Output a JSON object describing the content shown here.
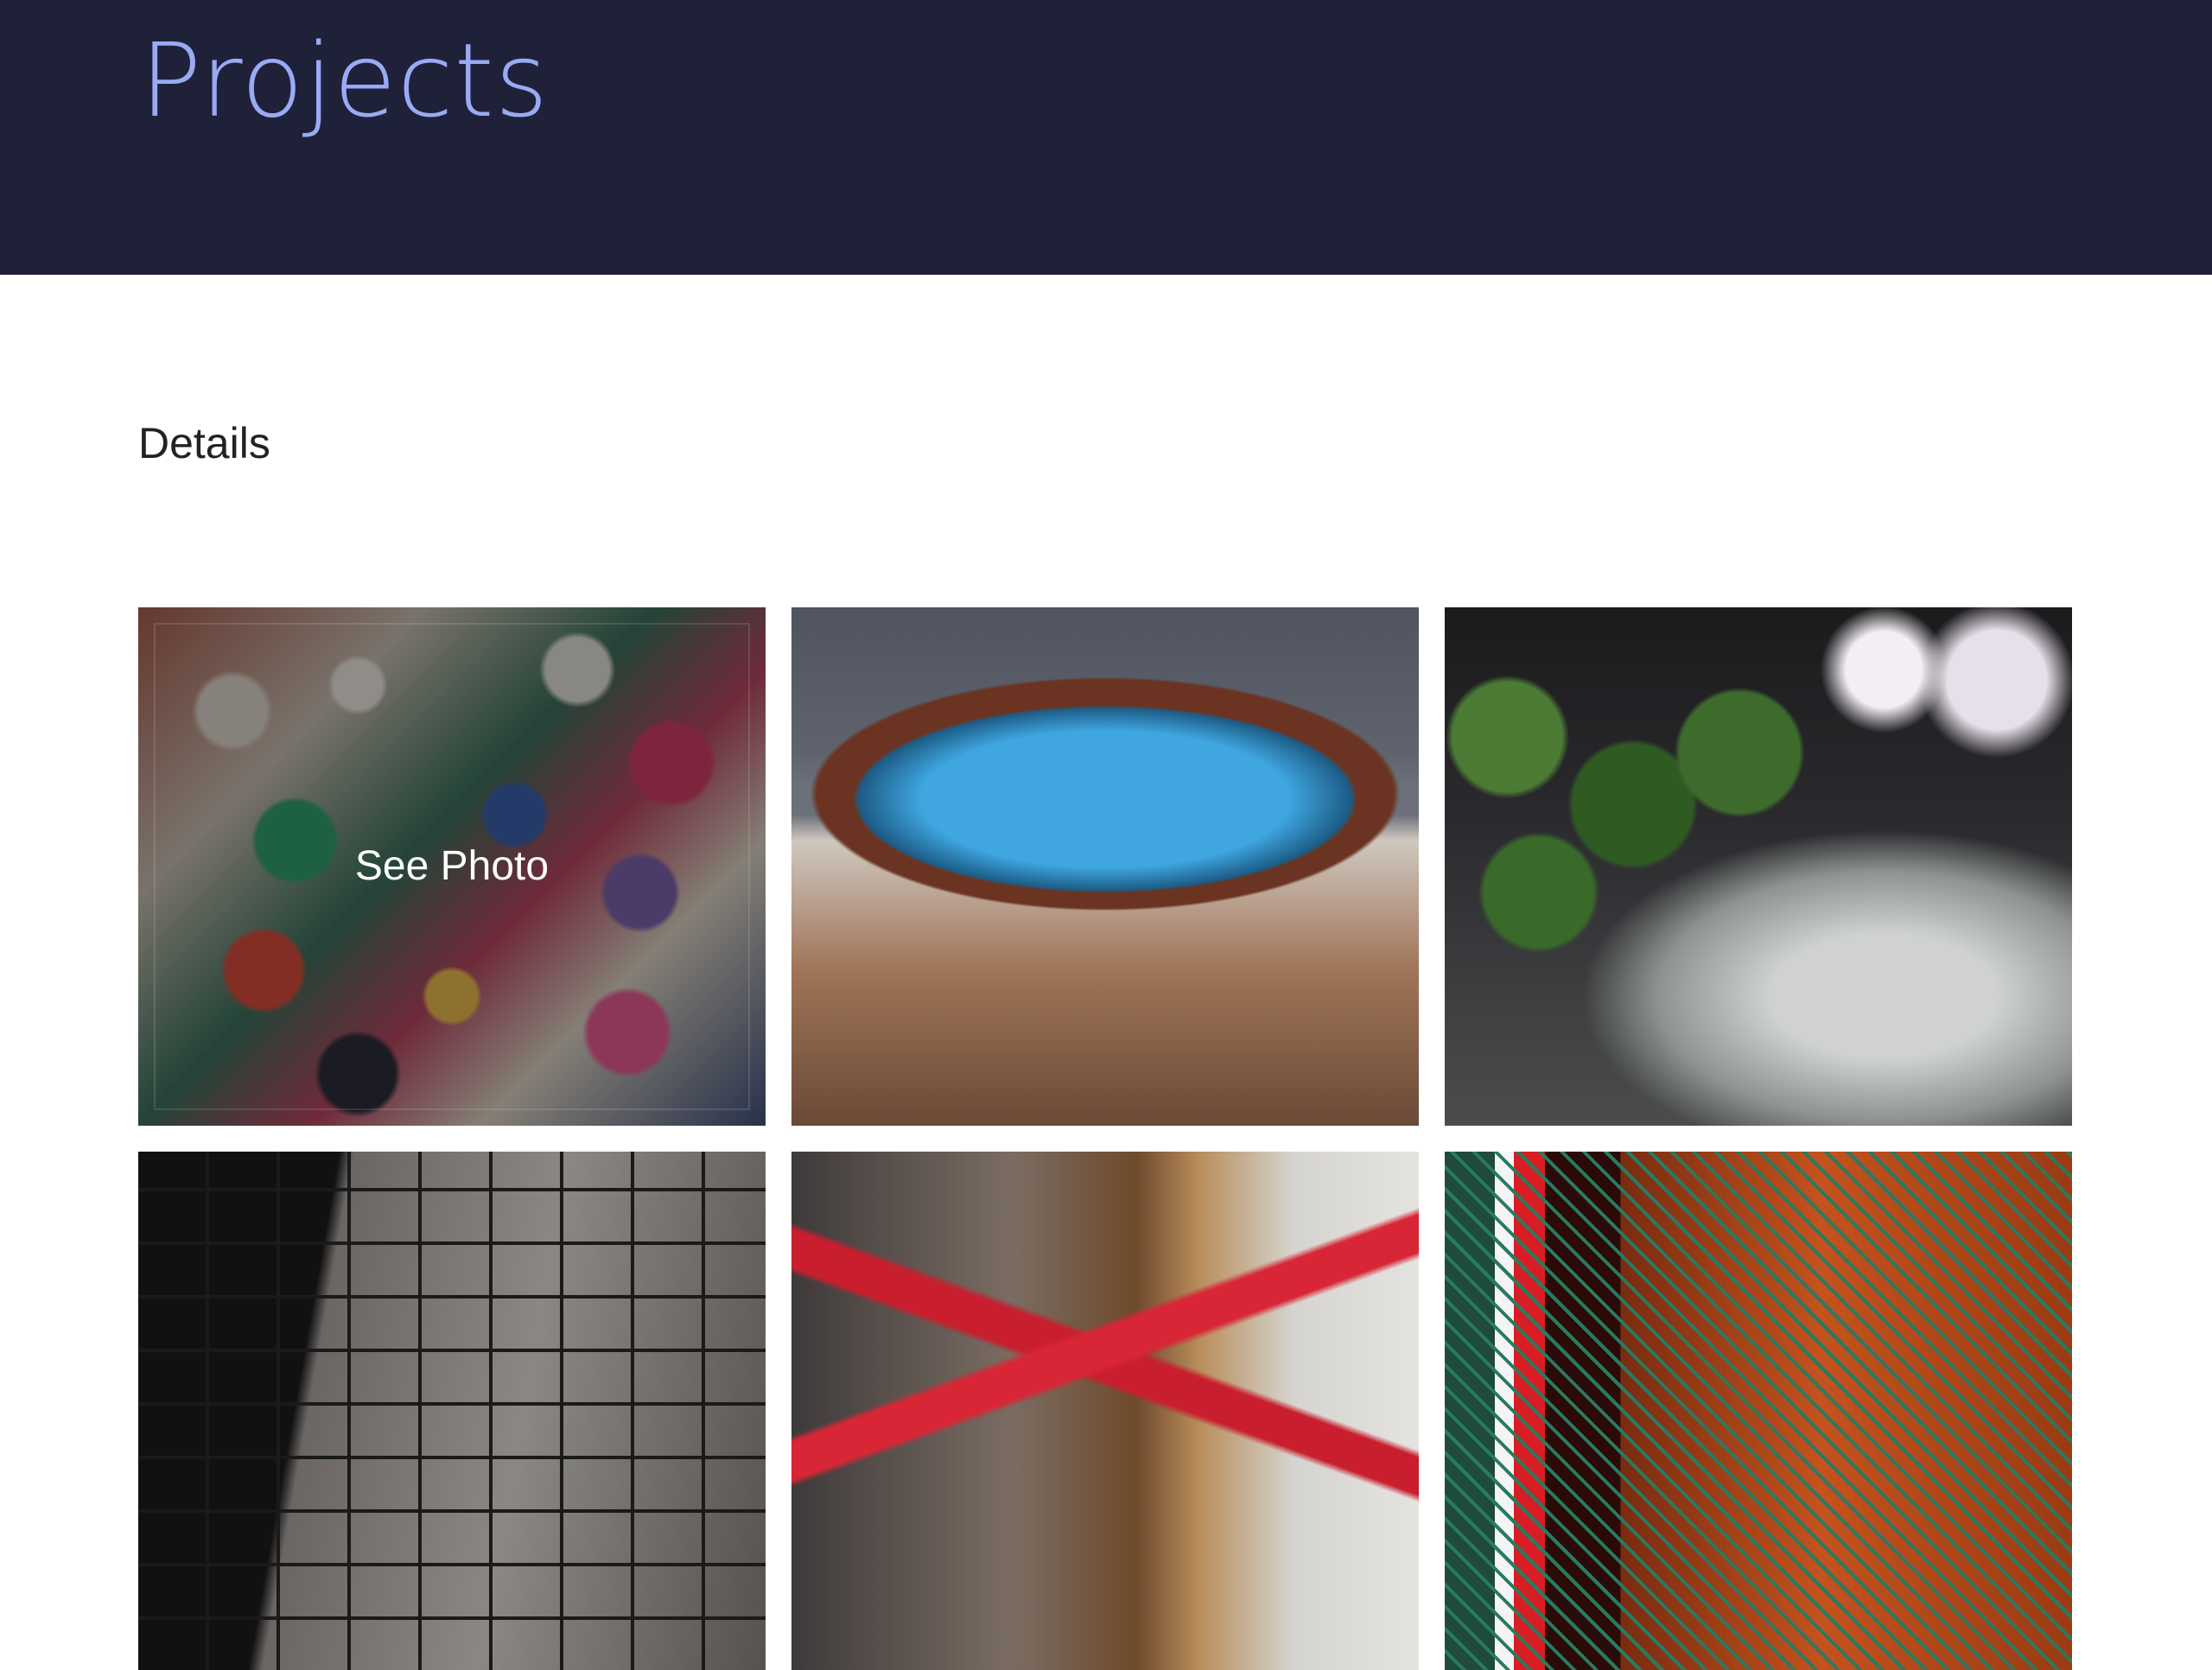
{
  "header": {
    "title": "Projects"
  },
  "section": {
    "heading": "Details"
  },
  "gallery": {
    "hover_label": "See Photo",
    "items": [
      {
        "id": 1,
        "subject": "paper-rolls"
      },
      {
        "id": 2,
        "subject": "rusty-barrel"
      },
      {
        "id": 3,
        "subject": "leaves"
      },
      {
        "id": 4,
        "subject": "tiled-wall"
      },
      {
        "id": 5,
        "subject": "red-ribbon"
      },
      {
        "id": 6,
        "subject": "red-white"
      }
    ]
  },
  "colors": {
    "header_bg": "#1f2139",
    "title": "#9aaaf4",
    "heading": "#222222",
    "page_bg": "#ffffff"
  }
}
